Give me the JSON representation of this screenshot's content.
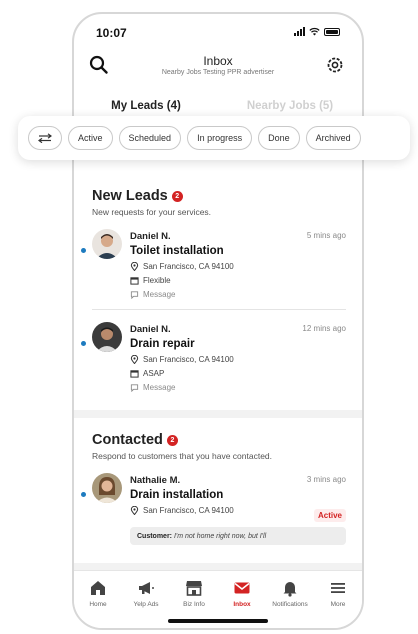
{
  "status": {
    "time": "10:07"
  },
  "header": {
    "title": "Inbox",
    "subtitle": "Nearby Jobs Testing PPR advertiser",
    "search_icon": "search-icon",
    "settings_icon": "gear-icon"
  },
  "tabs": [
    {
      "label": "My Leads (4)",
      "active": true
    },
    {
      "label": "Nearby Jobs (5)",
      "active": false
    }
  ],
  "filters": {
    "icon": "filter-icon",
    "chips": [
      "Active",
      "Scheduled",
      "In progress",
      "Done",
      "Archived"
    ]
  },
  "new_leads": {
    "title": "New Leads",
    "badge": "2",
    "description": "New requests for your services.",
    "items": [
      {
        "name": "Daniel N.",
        "time": "5 mins ago",
        "job": "Toilet installation",
        "location": "San Francisco, CA 94100",
        "schedule": "Flexible",
        "action": "Message"
      },
      {
        "name": "Daniel N.",
        "time": "12 mins ago",
        "job": "Drain repair",
        "location": "San Francisco, CA 94100",
        "schedule": "ASAP",
        "action": "Message"
      }
    ]
  },
  "contacted": {
    "title": "Contacted",
    "badge": "2",
    "description": "Respond to customers that you have contacted.",
    "items": [
      {
        "name": "Nathalie M.",
        "time": "3 mins ago",
        "job": "Drain installation",
        "location": "San Francisco, CA 94100",
        "status": "Active",
        "quote_label": "Customer:",
        "quote_text": "I'm not home right now, but I'll"
      }
    ]
  },
  "bottom_nav": [
    {
      "label": "Home",
      "icon": "home-icon",
      "active": false
    },
    {
      "label": "Yelp Ads",
      "icon": "megaphone-icon",
      "active": false
    },
    {
      "label": "Biz Info",
      "icon": "storefront-icon",
      "active": false
    },
    {
      "label": "Inbox",
      "icon": "mail-icon",
      "active": true
    },
    {
      "label": "Notifications",
      "icon": "bell-icon",
      "active": false
    },
    {
      "label": "More",
      "icon": "menu-icon",
      "active": false
    }
  ],
  "colors": {
    "accent": "#d32323",
    "unread": "#1d7bbf"
  }
}
